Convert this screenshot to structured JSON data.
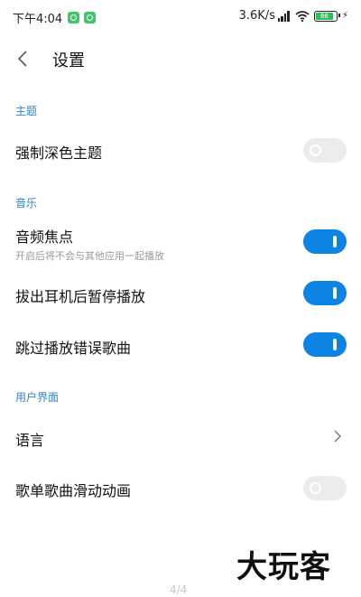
{
  "status_bar": {
    "time": "下午4:04",
    "speed": "3.6K/s",
    "network_type": "HD",
    "battery_level": "86",
    "notification_icons": [
      "app-notification-icon",
      "app-notification-icon"
    ]
  },
  "header": {
    "title": "设置"
  },
  "sections": {
    "theme": {
      "header": "主题",
      "items": {
        "dark_mode": {
          "title": "强制深色主题",
          "enabled": false
        }
      }
    },
    "music": {
      "header": "音乐",
      "items": {
        "audio_focus": {
          "title": "音频焦点",
          "subtitle": "开启后将不会与其他应用一起播放",
          "enabled": true
        },
        "pause_on_unplug": {
          "title": "拔出耳机后暂停播放",
          "enabled": true
        },
        "skip_errors": {
          "title": "跳过播放错误歌曲",
          "enabled": true
        }
      }
    },
    "ui": {
      "header": "用户界面",
      "items": {
        "language": {
          "title": "语言"
        },
        "scroll_animation": {
          "title": "歌单歌曲滑动动画",
          "enabled": false
        }
      }
    }
  },
  "watermark": "大玩客",
  "page_indicator": "4/4",
  "colors": {
    "accent": "#2c86d4",
    "toggle_on": "#0d84e3",
    "toggle_off": "#ececec"
  }
}
